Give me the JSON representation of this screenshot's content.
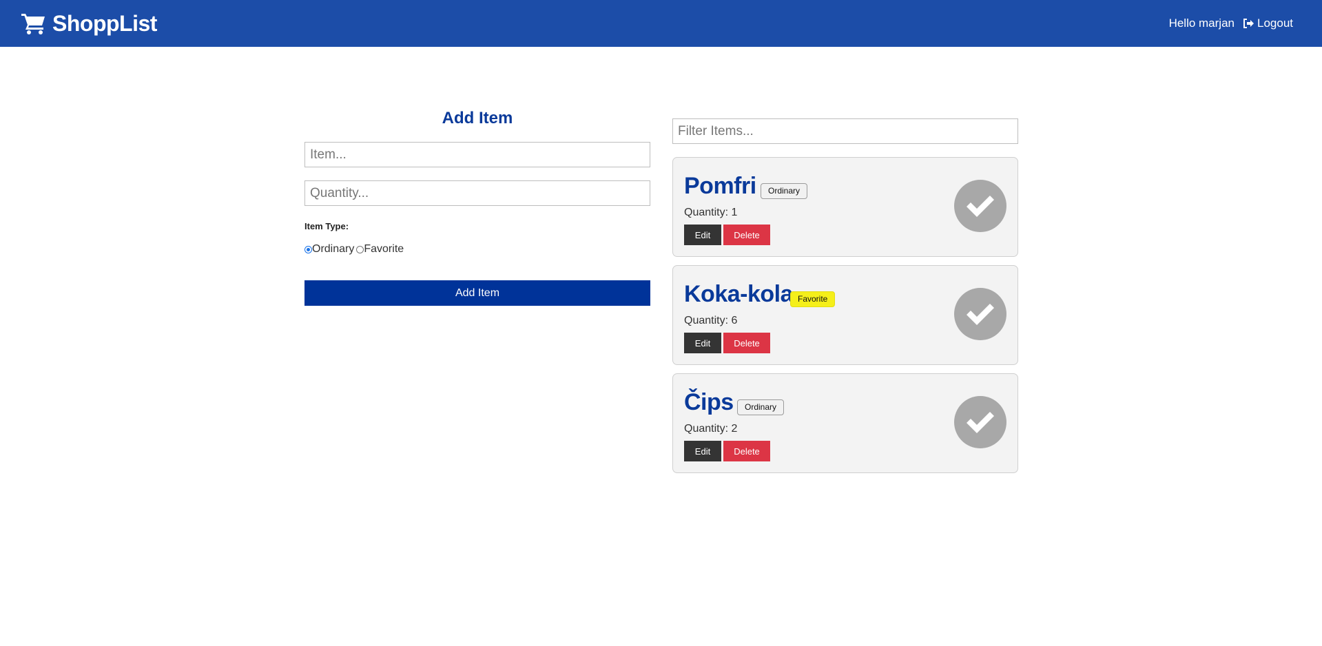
{
  "nav": {
    "brand": "ShoppList",
    "greeting": "Hello marjan",
    "logout_label": "Logout"
  },
  "form": {
    "title": "Add Item",
    "item_placeholder": "Item...",
    "quantity_placeholder": "Quantity...",
    "type_label": "Item Type:",
    "type_options": [
      {
        "label": "Ordinary",
        "checked": true
      },
      {
        "label": "Favorite",
        "checked": false
      }
    ],
    "submit_label": "Add Item"
  },
  "filter": {
    "placeholder": "Filter Items..."
  },
  "items": [
    {
      "name": "Pomfri",
      "type": "Ordinary",
      "quantity": "Quantity: 1",
      "edit_label": "Edit",
      "delete_label": "Delete"
    },
    {
      "name": "Koka-kola",
      "type": "Favorite",
      "quantity": "Quantity: 6",
      "edit_label": "Edit",
      "delete_label": "Delete"
    },
    {
      "name": "Čips",
      "type": "Ordinary",
      "quantity": "Quantity: 2",
      "edit_label": "Edit",
      "delete_label": "Delete"
    }
  ],
  "colors": {
    "navbar": "#1c4da8",
    "title": "#0a3a9a",
    "submit": "#003399",
    "delete": "#dc3545",
    "favorite_badge": "#f5ef1a",
    "check_circle": "#a8a8a8"
  },
  "icons": {
    "brand": "shopping-cart-icon",
    "logout": "sign-out-icon",
    "check": "check-circle-icon"
  }
}
